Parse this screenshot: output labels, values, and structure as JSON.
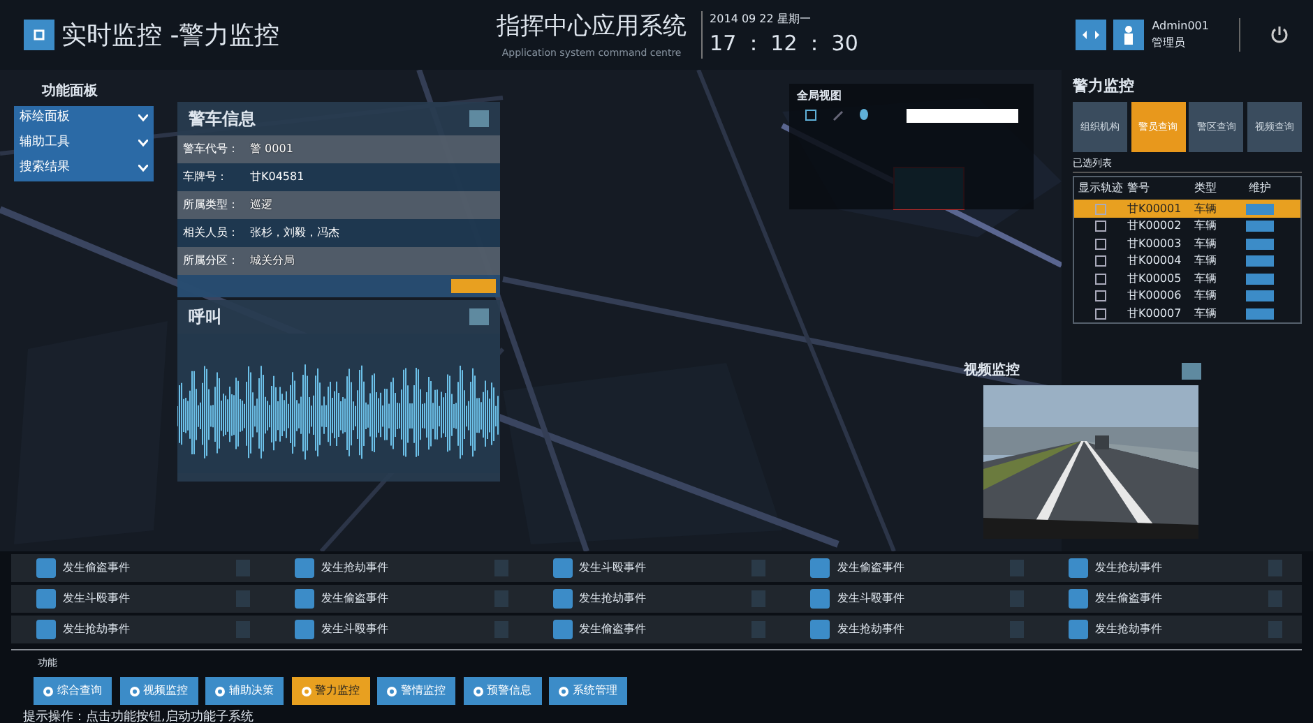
{
  "header": {
    "title": "实时监控 -警力监控",
    "system_name": "指挥中心应用系统",
    "system_subtitle": "Application system command centre",
    "date": "2014 09 22 星期一",
    "time": "17 ： 12 ： 30",
    "user": "Admin001",
    "role": "管理员"
  },
  "function_panel": {
    "title": "功能面板",
    "items": [
      {
        "label": "标绘面板"
      },
      {
        "label": "辅助工具"
      },
      {
        "label": "搜索结果"
      }
    ]
  },
  "car_info": {
    "title": "警车信息",
    "rows": [
      {
        "label": "警车代号：",
        "value": "警 0001"
      },
      {
        "label": "车牌号：",
        "value": "甘K04581"
      },
      {
        "label": "所属类型：",
        "value": "巡逻"
      },
      {
        "label": "相关人员：",
        "value": "张杉，刘毅，冯杰"
      },
      {
        "label": "所属分区：",
        "value": "城关分局"
      }
    ]
  },
  "call": {
    "title": "呼叫"
  },
  "overview": {
    "title": "全局视图"
  },
  "police_monitor": {
    "title": "警力监控",
    "tabs": [
      {
        "label": "组织机构",
        "selected": false
      },
      {
        "label": "警员查询",
        "selected": true
      },
      {
        "label": "警区查询",
        "selected": false
      },
      {
        "label": "视频查询",
        "selected": false
      }
    ],
    "list_title": "已选列表",
    "columns": [
      "显示轨迹",
      "警号",
      "类型",
      "维护"
    ],
    "rows": [
      {
        "number": "甘K00001",
        "type": "车辆",
        "checked": false,
        "selected": true
      },
      {
        "number": "甘K00002",
        "type": "车辆",
        "checked": false,
        "selected": false
      },
      {
        "number": "甘K00003",
        "type": "车辆",
        "checked": false,
        "selected": false
      },
      {
        "number": "甘K00004",
        "type": "车辆",
        "checked": false,
        "selected": false
      },
      {
        "number": "甘K00005",
        "type": "车辆",
        "checked": false,
        "selected": false
      },
      {
        "number": "甘K00006",
        "type": "车辆",
        "checked": false,
        "selected": false
      },
      {
        "number": "甘K00007",
        "type": "车辆",
        "checked": false,
        "selected": false
      }
    ]
  },
  "video": {
    "title": "视频监控",
    "kind": "picture"
  },
  "events": [
    {
      "text": "发生偷盗事件"
    },
    {
      "text": "发生抢劫事件"
    },
    {
      "text": "发生斗殴事件"
    },
    {
      "text": "发生偷盗事件"
    },
    {
      "text": "发生抢劫事件"
    },
    {
      "text": "发生斗殴事件"
    },
    {
      "text": "发生偷盗事件"
    },
    {
      "text": "发生抢劫事件"
    },
    {
      "text": "发生斗殴事件"
    },
    {
      "text": "发生偷盗事件"
    },
    {
      "text": "发生抢劫事件"
    },
    {
      "text": "发生斗殴事件"
    },
    {
      "text": "发生偷盗事件"
    },
    {
      "text": "发生抢劫事件"
    },
    {
      "text": "发生抢劫事件"
    }
  ],
  "functions": {
    "label": "功能",
    "buttons": [
      {
        "label": "综合查询",
        "selected": false
      },
      {
        "label": "视频监控",
        "selected": false
      },
      {
        "label": "辅助决策",
        "selected": false
      },
      {
        "label": "警力监控",
        "selected": true
      },
      {
        "label": "警情监控",
        "selected": false
      },
      {
        "label": "预警信息",
        "selected": false
      },
      {
        "label": "系统管理",
        "selected": false
      }
    ]
  },
  "hint": "提示操作：点击功能按钮,启动功能子系统"
}
